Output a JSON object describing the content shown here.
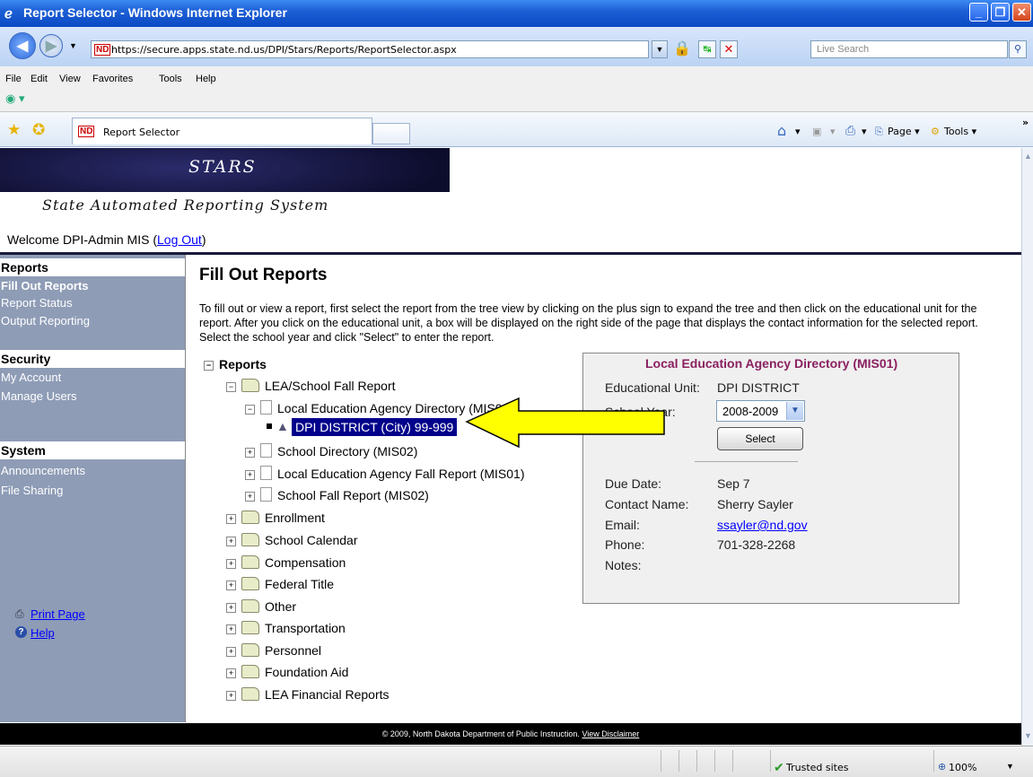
{
  "window": {
    "title": "Report Selector - Windows Internet Explorer",
    "url": "https://secure.apps.state.nd.us/DPI/Stars/Reports/ReportSelector.aspx",
    "search_placeholder": "Live Search"
  },
  "menubar": [
    "File",
    "Edit",
    "View",
    "Favorites",
    "Tools",
    "Help"
  ],
  "tab": {
    "label": "Report Selector",
    "favicon": "ND"
  },
  "commandbar": {
    "page": "Page",
    "tools": "Tools"
  },
  "banner": {
    "title": "STARS",
    "subtitle": "State Automated Reporting System"
  },
  "welcome": {
    "text": "Welcome DPI-Admin MIS (",
    "logout": "Log Out",
    "close": ")"
  },
  "sidebar": {
    "reports_header": "Reports",
    "reports_items": [
      "Fill Out Reports",
      "Report Status",
      "Output Reporting"
    ],
    "security_header": "Security",
    "security_items": [
      "My Account",
      "Manage Users"
    ],
    "system_header": "System",
    "system_items": [
      "Announcements",
      "File Sharing"
    ],
    "print_page": "Print Page",
    "help": "Help"
  },
  "main": {
    "title": "Fill Out Reports",
    "intro": "To fill out or view a report, first select the report from the tree view by clicking on the plus sign to expand the tree and then click on the educational unit for the report. After you click on the educational unit, a box will be displayed on the right side of the page that displays the contact information for the selected report. Select the school year and click \"Select\" to enter the report.",
    "tree": {
      "root": "Reports",
      "lea_folder": "LEA/School Fall Report",
      "lea_dir": "Local Education Agency Directory (MIS01)",
      "selected_node": "DPI DISTRICT (City) 99-999",
      "school_dir": "School Directory (MIS02)",
      "lea_fall": "Local Education Agency Fall Report (MIS01)",
      "school_fall": "School Fall Report (MIS02)",
      "folders": [
        "Enrollment",
        "School Calendar",
        "Compensation",
        "Federal Title",
        "Other",
        "Transportation",
        "Personnel",
        "Foundation Aid",
        "LEA Financial Reports"
      ]
    }
  },
  "infobox": {
    "title": "Local Education Agency Directory (MIS01)",
    "edu_unit_label": "Educational Unit:",
    "edu_unit_value": "DPI DISTRICT",
    "school_year_label": "School Year:",
    "school_year_value": "2008-2009",
    "select_button": "Select",
    "due_date_label": "Due Date:",
    "due_date_value": "Sep 7",
    "contact_label": "Contact Name:",
    "contact_value": "Sherry Sayler",
    "email_label": "Email:",
    "email_value": "ssayler@nd.gov",
    "phone_label": "Phone:",
    "phone_value": "701-328-2268",
    "notes_label": "Notes:"
  },
  "footer": {
    "text": "© 2009, North Dakota Department of Public Instruction. ",
    "disclaimer": "View Disclaimer"
  },
  "statusbar": {
    "zone": "Trusted sites",
    "zoom": "100%"
  },
  "colors": {
    "accent_arrow": "#ffff00",
    "selected_bg": "#00008b",
    "sidebar_bg": "#8e9cb6",
    "info_title": "#8a2060"
  }
}
